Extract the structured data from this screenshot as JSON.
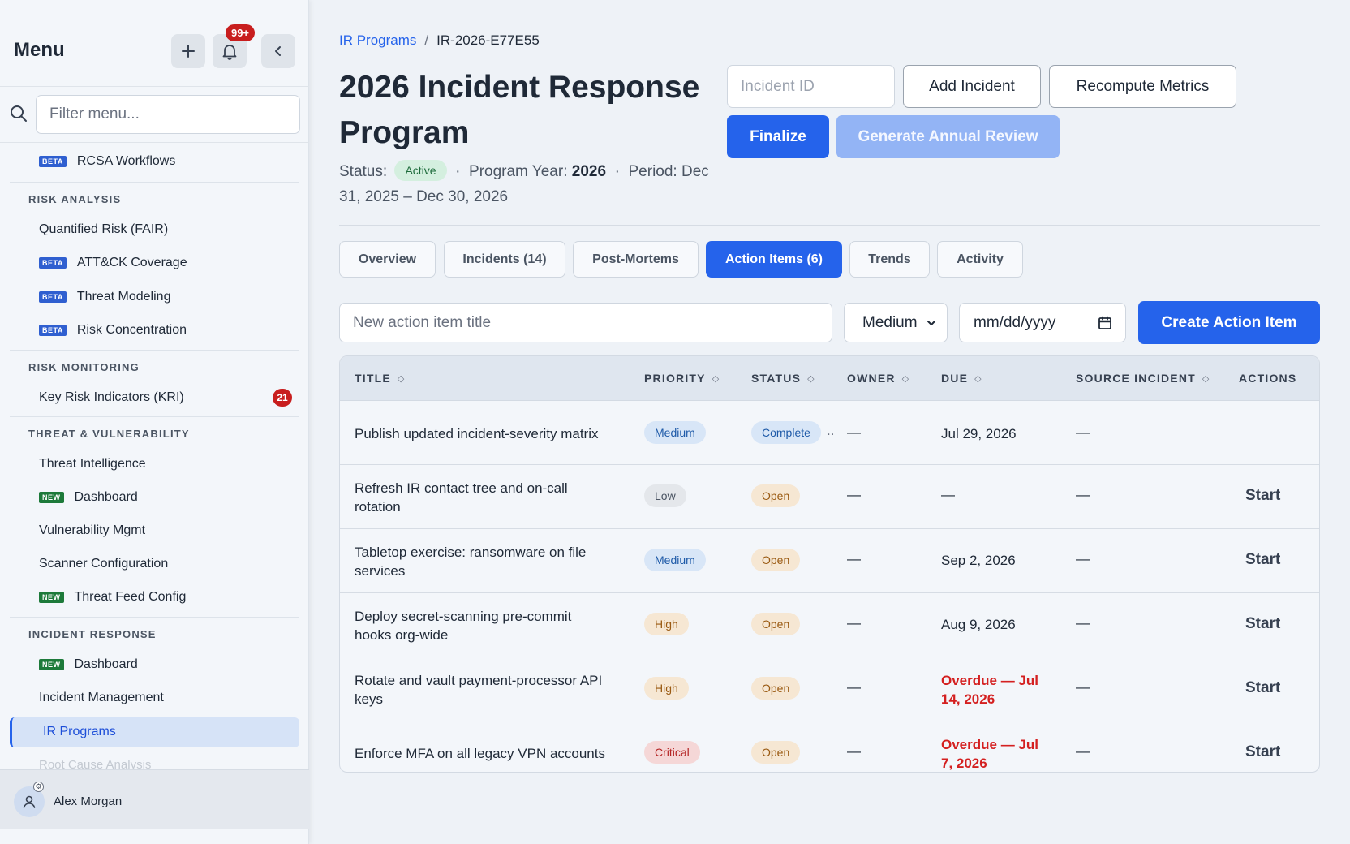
{
  "sidebar": {
    "title": "Menu",
    "notifications_badge": "99+",
    "filter_placeholder": "Filter menu...",
    "items": {
      "rcsa": {
        "tag": "BETA",
        "label": "RCSA Workflows"
      },
      "risk_analysis_header": "RISK ANALYSIS",
      "fair": {
        "label": "Quantified Risk (FAIR)"
      },
      "attack": {
        "tag": "BETA",
        "label": "ATT&CK Coverage"
      },
      "threat_modeling": {
        "tag": "BETA",
        "label": "Threat Modeling"
      },
      "risk_concentration": {
        "tag": "BETA",
        "label": "Risk Concentration"
      },
      "risk_monitoring_header": "RISK MONITORING",
      "kri": {
        "label": "Key Risk Indicators (KRI)",
        "count": "21"
      },
      "tv_header": "THREAT & VULNERABILITY",
      "threat_intel": {
        "label": "Threat Intelligence"
      },
      "tv_dashboard": {
        "tag": "NEW",
        "label": "Dashboard"
      },
      "vuln_mgmt": {
        "label": "Vulnerability Mgmt"
      },
      "scanner": {
        "label": "Scanner Configuration"
      },
      "threat_feed": {
        "tag": "NEW",
        "label": "Threat Feed Config"
      },
      "ir_header": "INCIDENT RESPONSE",
      "ir_dashboard": {
        "tag": "NEW",
        "label": "Dashboard"
      },
      "incident_mgmt": {
        "label": "Incident Management"
      },
      "ir_programs": {
        "label": "IR Programs"
      },
      "rca": {
        "label": "Root Cause Analysis"
      }
    },
    "user": {
      "name": "Alex Morgan"
    }
  },
  "breadcrumb": {
    "parent": "IR Programs",
    "separator": "/",
    "current": "IR-2026-E77E55"
  },
  "header": {
    "title": "2026 Incident Response Program",
    "status_label": "Status:",
    "status_value": "Active",
    "sep": "·",
    "year_label": "Program Year:",
    "year_value": "2026",
    "period_text": "Period: Dec 31, 2025 – Dec 30, 2026"
  },
  "actions": {
    "incident_placeholder": "Incident ID",
    "add_incident": "Add Incident",
    "recompute": "Recompute Metrics",
    "finalize": "Finalize",
    "annual_review": "Generate Annual Review"
  },
  "tabs": [
    {
      "label": "Overview",
      "active": false
    },
    {
      "label": "Incidents (14)",
      "active": false
    },
    {
      "label": "Post-Mortems",
      "active": false
    },
    {
      "label": "Action Items (6)",
      "active": true
    },
    {
      "label": "Trends",
      "active": false
    },
    {
      "label": "Activity",
      "active": false
    }
  ],
  "create_form": {
    "title_placeholder": "New action item title",
    "priority_value": "Medium",
    "date_placeholder": "mm/dd/yyyy",
    "submit": "Create Action Item"
  },
  "table": {
    "columns": [
      "TITLE",
      "PRIORITY",
      "STATUS",
      "OWNER",
      "DUE",
      "SOURCE INCIDENT",
      "ACTIONS"
    ],
    "rows": [
      {
        "title_l1": "Publish updated incident-severity matrix",
        "title_l2": "",
        "priority": "Medium",
        "status": "Complete",
        "owner": "—",
        "due_l1": "Jul 29, 2026",
        "due_l2": "",
        "overdue": false,
        "source": "—",
        "action": ""
      },
      {
        "title_l1": "Refresh IR contact tree and on-call",
        "title_l2": "rotation",
        "priority": "Low",
        "status": "Open",
        "owner": "—",
        "due_l1": "—",
        "due_l2": "",
        "overdue": false,
        "source": "—",
        "action": "Start"
      },
      {
        "title_l1": "Tabletop exercise: ransomware on file",
        "title_l2": "services",
        "priority": "Medium",
        "status": "Open",
        "owner": "—",
        "due_l1": "Sep 2, 2026",
        "due_l2": "",
        "overdue": false,
        "source": "—",
        "action": "Start"
      },
      {
        "title_l1": "Deploy secret-scanning pre-commit",
        "title_l2": "hooks org-wide",
        "priority": "High",
        "status": "Open",
        "owner": "—",
        "due_l1": "Aug 9, 2026",
        "due_l2": "",
        "overdue": false,
        "source": "—",
        "action": "Start"
      },
      {
        "title_l1": "Rotate and vault payment-processor API",
        "title_l2": "keys",
        "priority": "High",
        "status": "Open",
        "owner": "—",
        "due_l1": "Overdue — Jul",
        "due_l2": "14, 2026",
        "overdue": true,
        "source": "—",
        "action": "Start"
      },
      {
        "title_l1": "Enforce MFA on all legacy VPN accounts",
        "title_l2": "",
        "priority": "Critical",
        "status": "Open",
        "owner": "—",
        "due_l1": "Overdue — Jul",
        "due_l2": "7, 2026",
        "overdue": true,
        "source": "—",
        "action": "Start"
      }
    ]
  },
  "colors": {
    "accent": "#2563eb",
    "danger": "#d42020",
    "success": "#1d6b3b"
  }
}
